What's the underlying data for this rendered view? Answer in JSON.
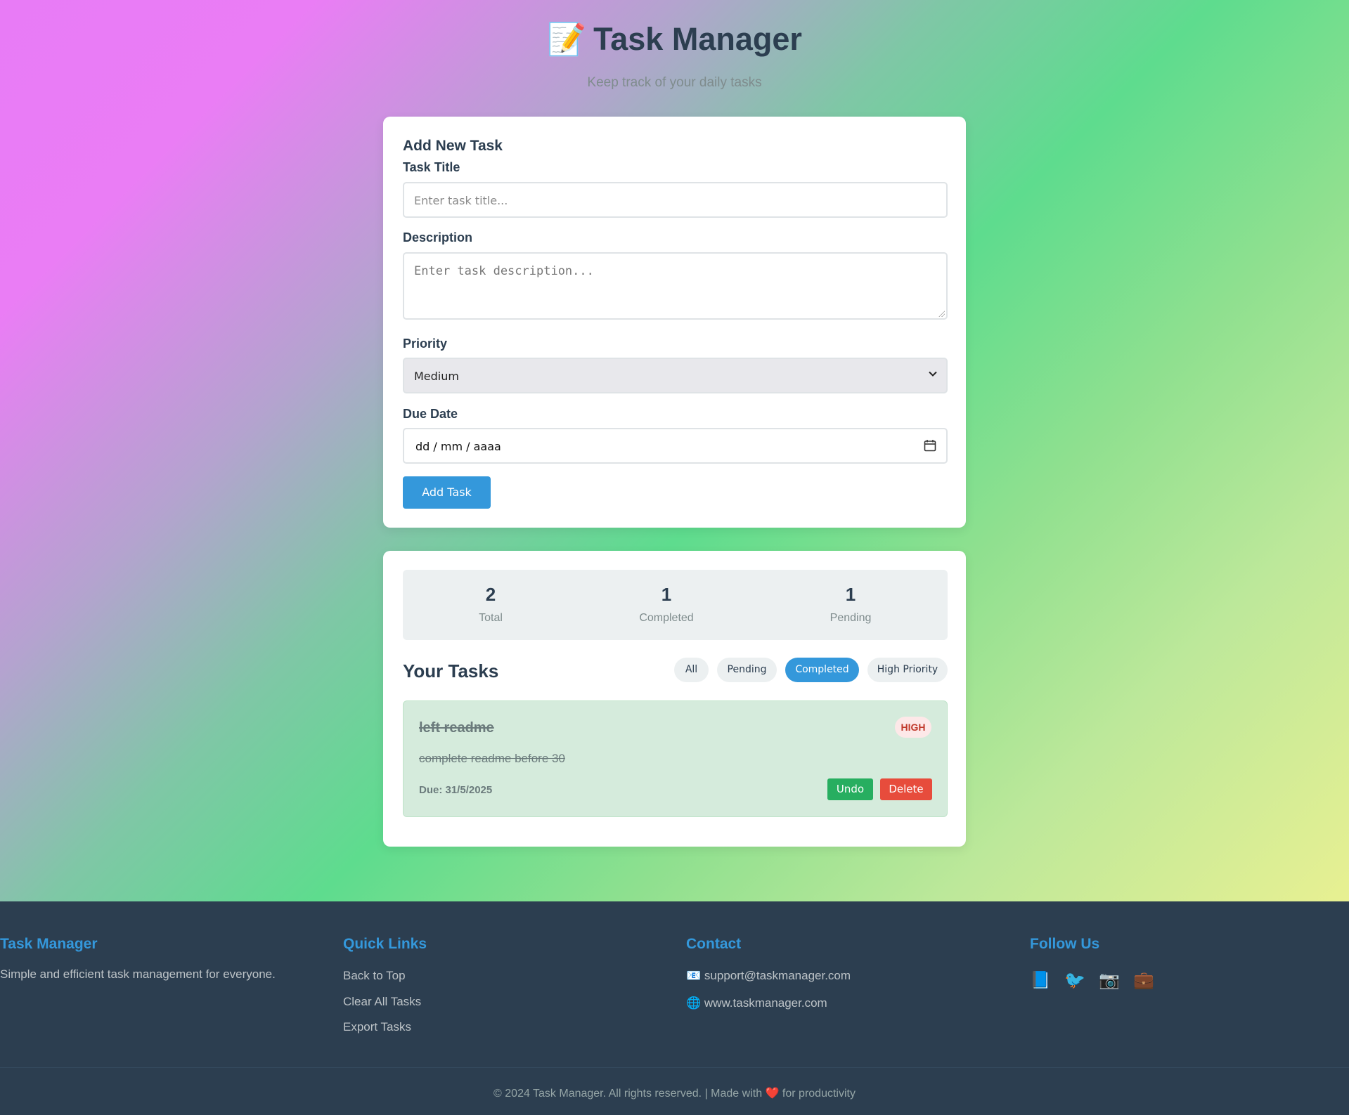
{
  "header": {
    "icon": "memo-pencil-icon",
    "emoji": "📝",
    "title": "Task Manager",
    "subtitle": "Keep track of your daily tasks"
  },
  "form": {
    "heading": "Add New Task",
    "title_label": "Task Title",
    "title_placeholder": "Enter task title...",
    "description_label": "Description",
    "description_placeholder": "Enter task description...",
    "priority_label": "Priority",
    "priority_value": "Medium",
    "due_label": "Due Date",
    "due_placeholder": "dd / mm / aaaa",
    "add_button": "Add Task"
  },
  "stats": [
    {
      "value": "2",
      "label": "Total"
    },
    {
      "value": "1",
      "label": "Completed"
    },
    {
      "value": "1",
      "label": "Pending"
    }
  ],
  "tasks": {
    "heading": "Your Tasks",
    "filters": [
      {
        "label": "All",
        "active": false
      },
      {
        "label": "Pending",
        "active": false
      },
      {
        "label": "Completed",
        "active": true
      },
      {
        "label": "High Priority",
        "active": false
      }
    ],
    "items": [
      {
        "title": "left readme",
        "priority": "HIGH",
        "description": "complete readme before 30",
        "due": "Due: 31/5/2025",
        "undo_label": "Undo",
        "delete_label": "Delete"
      }
    ]
  },
  "footer": {
    "brand_title": "Task Manager",
    "brand_text": "Simple and efficient task management for everyone.",
    "quick_links_title": "Quick Links",
    "quick_links": [
      "Back to Top",
      "Clear All Tasks",
      "Export Tasks"
    ],
    "contact_title": "Contact",
    "contact_email_icon": "📧",
    "contact_email": "support@taskmanager.com",
    "contact_web_icon": "🌐",
    "contact_web": "www.taskmanager.com",
    "follow_title": "Follow Us",
    "social_icons": [
      "📘",
      "🐦",
      "📷",
      "💼"
    ],
    "copyright_prefix": "© 2024 Task Manager. All rights reserved. | Made with",
    "heart": "❤️",
    "copyright_suffix": "for productivity"
  },
  "colors": {
    "accent": "#3498db",
    "text": "#2c3e50",
    "success": "#27ae60",
    "danger": "#e74c3c",
    "footer_bg": "#2c3e50"
  }
}
